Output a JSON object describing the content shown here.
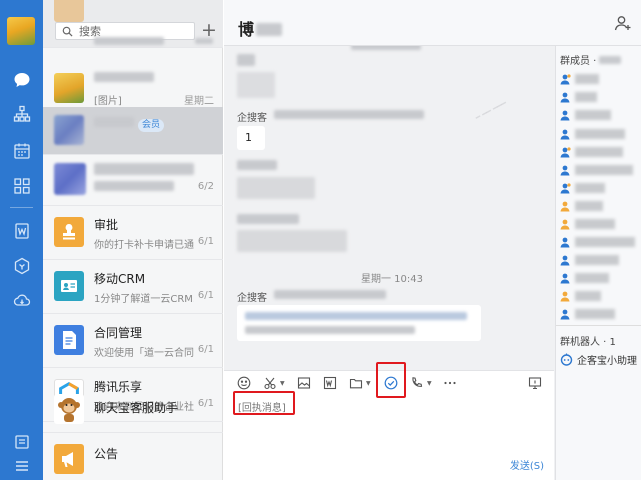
{
  "sidebar": {
    "icons": [
      "chat-icon",
      "org-icon",
      "calendar-icon",
      "apps-icon",
      "doc-icon",
      "cube-icon",
      "cloud-icon",
      "message-board-icon",
      "menu-icon"
    ]
  },
  "conversation_list": {
    "search_placeholder": "搜索",
    "add_label": "+",
    "items": [
      {
        "title": "",
        "subtitle": "",
        "date": ""
      },
      {
        "title": "",
        "subtitle": "[图片]",
        "date": "星期二"
      },
      {
        "title": "",
        "badge": "会员",
        "subtitle": "",
        "date": ""
      },
      {
        "title": "",
        "subtitle": "",
        "date": "6/2"
      },
      {
        "title": "审批",
        "subtitle": "你的打卡补卡申请已通过",
        "date": "6/1"
      },
      {
        "title": "移动CRM",
        "subtitle": "1分钟了解道一云CRM...",
        "date": "6/1"
      },
      {
        "title": "合同管理",
        "subtitle": "欢迎使用「道一云合同...",
        "date": "6/1"
      },
      {
        "title": "腾讯乐享",
        "subtitle": "欢迎来到我们的企业社...",
        "date": "6/1"
      },
      {
        "title": "聊天宝客服助手",
        "subtitle": "",
        "date": ""
      },
      {
        "title": "公告",
        "subtitle": "",
        "date": ""
      }
    ]
  },
  "chat": {
    "title": "博",
    "messages": {
      "sender_1": "企搜客",
      "bubble_number": "1",
      "time_2": "星期一 10:43",
      "sender_2": "企搜客"
    },
    "members_title": "群成员 ·",
    "robots_title": "群机器人 · 1",
    "robot_name": "企客宝小助理",
    "input_quote": "[回执消息]",
    "send_label": "发送(S)",
    "toolbar_icons": [
      "emoji-icon",
      "scissors-icon",
      "image-icon",
      "word-icon",
      "folder-icon",
      "receipt-check-icon",
      "phone-icon",
      "more-icon",
      "screen-share-icon"
    ]
  },
  "colors": {
    "rail": "#2d78d0",
    "highlight": "#e0191e",
    "accent": "#3c86d6"
  }
}
